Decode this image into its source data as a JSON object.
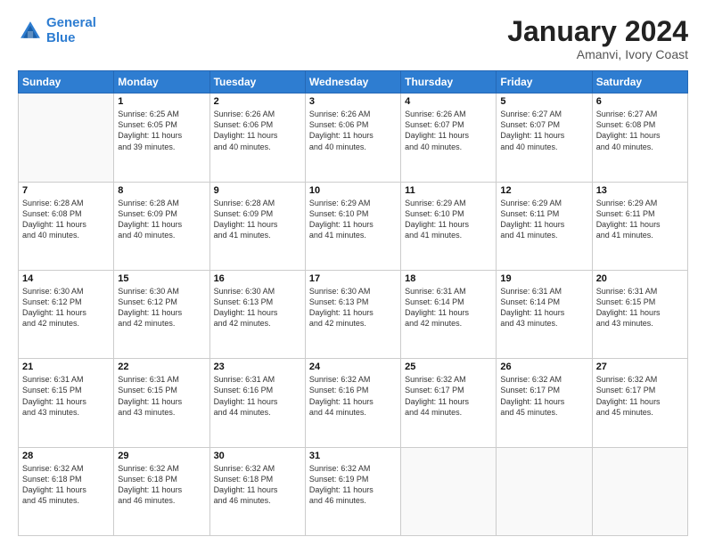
{
  "logo": {
    "line1": "General",
    "line2": "Blue"
  },
  "title": "January 2024",
  "subtitle": "Amanvi, Ivory Coast",
  "days_header": [
    "Sunday",
    "Monday",
    "Tuesday",
    "Wednesday",
    "Thursday",
    "Friday",
    "Saturday"
  ],
  "weeks": [
    [
      {
        "num": "",
        "info": ""
      },
      {
        "num": "1",
        "info": "Sunrise: 6:25 AM\nSunset: 6:05 PM\nDaylight: 11 hours\nand 39 minutes."
      },
      {
        "num": "2",
        "info": "Sunrise: 6:26 AM\nSunset: 6:06 PM\nDaylight: 11 hours\nand 40 minutes."
      },
      {
        "num": "3",
        "info": "Sunrise: 6:26 AM\nSunset: 6:06 PM\nDaylight: 11 hours\nand 40 minutes."
      },
      {
        "num": "4",
        "info": "Sunrise: 6:26 AM\nSunset: 6:07 PM\nDaylight: 11 hours\nand 40 minutes."
      },
      {
        "num": "5",
        "info": "Sunrise: 6:27 AM\nSunset: 6:07 PM\nDaylight: 11 hours\nand 40 minutes."
      },
      {
        "num": "6",
        "info": "Sunrise: 6:27 AM\nSunset: 6:08 PM\nDaylight: 11 hours\nand 40 minutes."
      }
    ],
    [
      {
        "num": "7",
        "info": "Sunrise: 6:28 AM\nSunset: 6:08 PM\nDaylight: 11 hours\nand 40 minutes."
      },
      {
        "num": "8",
        "info": "Sunrise: 6:28 AM\nSunset: 6:09 PM\nDaylight: 11 hours\nand 40 minutes."
      },
      {
        "num": "9",
        "info": "Sunrise: 6:28 AM\nSunset: 6:09 PM\nDaylight: 11 hours\nand 41 minutes."
      },
      {
        "num": "10",
        "info": "Sunrise: 6:29 AM\nSunset: 6:10 PM\nDaylight: 11 hours\nand 41 minutes."
      },
      {
        "num": "11",
        "info": "Sunrise: 6:29 AM\nSunset: 6:10 PM\nDaylight: 11 hours\nand 41 minutes."
      },
      {
        "num": "12",
        "info": "Sunrise: 6:29 AM\nSunset: 6:11 PM\nDaylight: 11 hours\nand 41 minutes."
      },
      {
        "num": "13",
        "info": "Sunrise: 6:29 AM\nSunset: 6:11 PM\nDaylight: 11 hours\nand 41 minutes."
      }
    ],
    [
      {
        "num": "14",
        "info": "Sunrise: 6:30 AM\nSunset: 6:12 PM\nDaylight: 11 hours\nand 42 minutes."
      },
      {
        "num": "15",
        "info": "Sunrise: 6:30 AM\nSunset: 6:12 PM\nDaylight: 11 hours\nand 42 minutes."
      },
      {
        "num": "16",
        "info": "Sunrise: 6:30 AM\nSunset: 6:13 PM\nDaylight: 11 hours\nand 42 minutes."
      },
      {
        "num": "17",
        "info": "Sunrise: 6:30 AM\nSunset: 6:13 PM\nDaylight: 11 hours\nand 42 minutes."
      },
      {
        "num": "18",
        "info": "Sunrise: 6:31 AM\nSunset: 6:14 PM\nDaylight: 11 hours\nand 42 minutes."
      },
      {
        "num": "19",
        "info": "Sunrise: 6:31 AM\nSunset: 6:14 PM\nDaylight: 11 hours\nand 43 minutes."
      },
      {
        "num": "20",
        "info": "Sunrise: 6:31 AM\nSunset: 6:15 PM\nDaylight: 11 hours\nand 43 minutes."
      }
    ],
    [
      {
        "num": "21",
        "info": "Sunrise: 6:31 AM\nSunset: 6:15 PM\nDaylight: 11 hours\nand 43 minutes."
      },
      {
        "num": "22",
        "info": "Sunrise: 6:31 AM\nSunset: 6:15 PM\nDaylight: 11 hours\nand 43 minutes."
      },
      {
        "num": "23",
        "info": "Sunrise: 6:31 AM\nSunset: 6:16 PM\nDaylight: 11 hours\nand 44 minutes."
      },
      {
        "num": "24",
        "info": "Sunrise: 6:32 AM\nSunset: 6:16 PM\nDaylight: 11 hours\nand 44 minutes."
      },
      {
        "num": "25",
        "info": "Sunrise: 6:32 AM\nSunset: 6:17 PM\nDaylight: 11 hours\nand 44 minutes."
      },
      {
        "num": "26",
        "info": "Sunrise: 6:32 AM\nSunset: 6:17 PM\nDaylight: 11 hours\nand 45 minutes."
      },
      {
        "num": "27",
        "info": "Sunrise: 6:32 AM\nSunset: 6:17 PM\nDaylight: 11 hours\nand 45 minutes."
      }
    ],
    [
      {
        "num": "28",
        "info": "Sunrise: 6:32 AM\nSunset: 6:18 PM\nDaylight: 11 hours\nand 45 minutes."
      },
      {
        "num": "29",
        "info": "Sunrise: 6:32 AM\nSunset: 6:18 PM\nDaylight: 11 hours\nand 46 minutes."
      },
      {
        "num": "30",
        "info": "Sunrise: 6:32 AM\nSunset: 6:18 PM\nDaylight: 11 hours\nand 46 minutes."
      },
      {
        "num": "31",
        "info": "Sunrise: 6:32 AM\nSunset: 6:19 PM\nDaylight: 11 hours\nand 46 minutes."
      },
      {
        "num": "",
        "info": ""
      },
      {
        "num": "",
        "info": ""
      },
      {
        "num": "",
        "info": ""
      }
    ]
  ]
}
